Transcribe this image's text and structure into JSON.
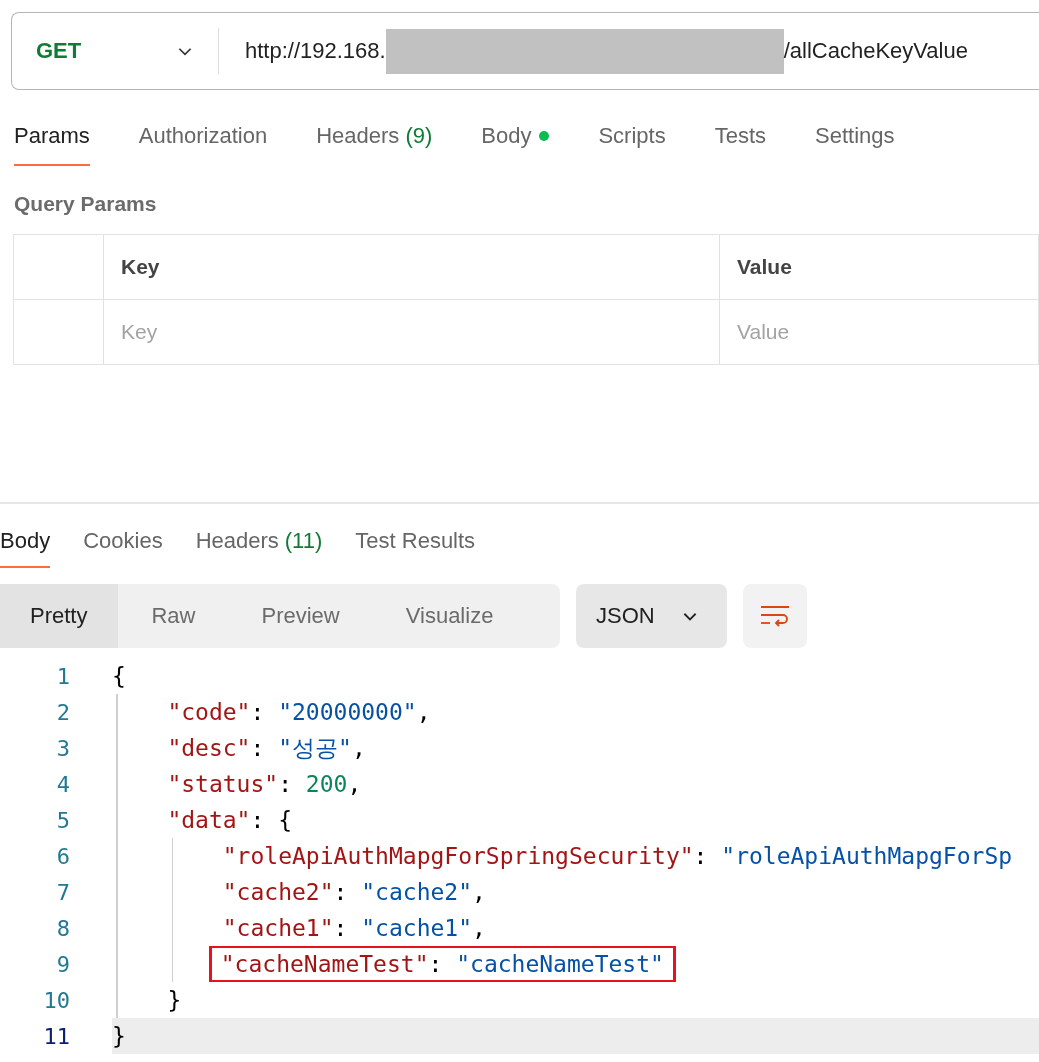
{
  "request": {
    "method": "GET",
    "url_parts": [
      {
        "kind": "text",
        "text": "http://192.168."
      },
      {
        "kind": "redacted"
      },
      {
        "kind": "text",
        "text": "/allCacheKeyValue"
      }
    ]
  },
  "request_tabs": [
    {
      "label": "Params",
      "dot": false,
      "selected": true
    },
    {
      "label": "Authorization",
      "dot": false,
      "selected": false
    },
    {
      "label": "Headers",
      "count": "(9)",
      "dot": false,
      "selected": false
    },
    {
      "label": "Body",
      "dot": true,
      "selected": false
    },
    {
      "label": "Scripts",
      "dot": false,
      "selected": false
    },
    {
      "label": "Tests",
      "dot": false,
      "selected": false
    },
    {
      "label": "Settings",
      "dot": false,
      "selected": false
    }
  ],
  "query_params": {
    "title": "Query Params",
    "columns": [
      "Key",
      "Value"
    ],
    "placeholders": [
      "Key",
      "Value"
    ]
  },
  "response_tabs": [
    {
      "label": "Body",
      "selected": true
    },
    {
      "label": "Cookies",
      "selected": false
    },
    {
      "label": "Headers",
      "count": "(11)",
      "selected": false
    },
    {
      "label": "Test Results",
      "selected": false
    }
  ],
  "view_modes": [
    {
      "label": "Pretty",
      "selected": true
    },
    {
      "label": "Raw",
      "selected": false
    },
    {
      "label": "Preview",
      "selected": false
    },
    {
      "label": "Visualize",
      "selected": false
    }
  ],
  "format": "JSON",
  "code": [
    {
      "number": "1",
      "current": false,
      "boxed": false,
      "tokens": [
        {
          "kind": "punct",
          "text": "{"
        }
      ],
      "children": [
        {
          "number": "2",
          "current": false,
          "boxed": false,
          "tokens": [
            {
              "kind": "key",
              "text": "\"code\""
            },
            {
              "kind": "punct",
              "text": ": "
            },
            {
              "kind": "string",
              "text": "\"20000000\""
            },
            {
              "kind": "punct",
              "text": ","
            }
          ]
        },
        {
          "number": "3",
          "current": false,
          "boxed": false,
          "tokens": [
            {
              "kind": "key",
              "text": "\"desc\""
            },
            {
              "kind": "punct",
              "text": ": "
            },
            {
              "kind": "string",
              "text": "\"성공\""
            },
            {
              "kind": "punct",
              "text": ","
            }
          ]
        },
        {
          "number": "4",
          "current": false,
          "boxed": false,
          "tokens": [
            {
              "kind": "key",
              "text": "\"status\""
            },
            {
              "kind": "punct",
              "text": ": "
            },
            {
              "kind": "number",
              "text": "200"
            },
            {
              "kind": "punct",
              "text": ","
            }
          ]
        },
        {
          "number": "5",
          "current": false,
          "boxed": false,
          "tokens": [
            {
              "kind": "key",
              "text": "\"data\""
            },
            {
              "kind": "punct",
              "text": ": {"
            }
          ],
          "children": [
            {
              "number": "6",
              "current": false,
              "boxed": false,
              "tokens": [
                {
                  "kind": "key",
                  "text": "\"roleApiAuthMapgForSpringSecurity\""
                },
                {
                  "kind": "punct",
                  "text": ": "
                },
                {
                  "kind": "string",
                  "text": "\"roleApiAuthMapgForSp"
                }
              ]
            },
            {
              "number": "7",
              "current": false,
              "boxed": false,
              "tokens": [
                {
                  "kind": "key",
                  "text": "\"cache2\""
                },
                {
                  "kind": "punct",
                  "text": ": "
                },
                {
                  "kind": "string",
                  "text": "\"cache2\""
                },
                {
                  "kind": "punct",
                  "text": ","
                }
              ]
            },
            {
              "number": "8",
              "current": false,
              "boxed": false,
              "tokens": [
                {
                  "kind": "key",
                  "text": "\"cache1\""
                },
                {
                  "kind": "punct",
                  "text": ": "
                },
                {
                  "kind": "string",
                  "text": "\"cache1\""
                },
                {
                  "kind": "punct",
                  "text": ","
                }
              ]
            },
            {
              "number": "9",
              "current": false,
              "boxed": true,
              "tokens": [
                {
                  "kind": "key",
                  "text": "\"cacheNameTest\""
                },
                {
                  "kind": "punct",
                  "text": ": "
                },
                {
                  "kind": "string",
                  "text": "\"cacheNameTest\""
                }
              ]
            }
          ]
        },
        {
          "number": "10",
          "current": false,
          "boxed": false,
          "tokens": [
            {
              "kind": "punct",
              "text": "}"
            }
          ]
        }
      ]
    },
    {
      "number": "11",
      "current": true,
      "boxed": false,
      "tokens": [
        {
          "kind": "punct",
          "text": "}"
        }
      ]
    }
  ]
}
